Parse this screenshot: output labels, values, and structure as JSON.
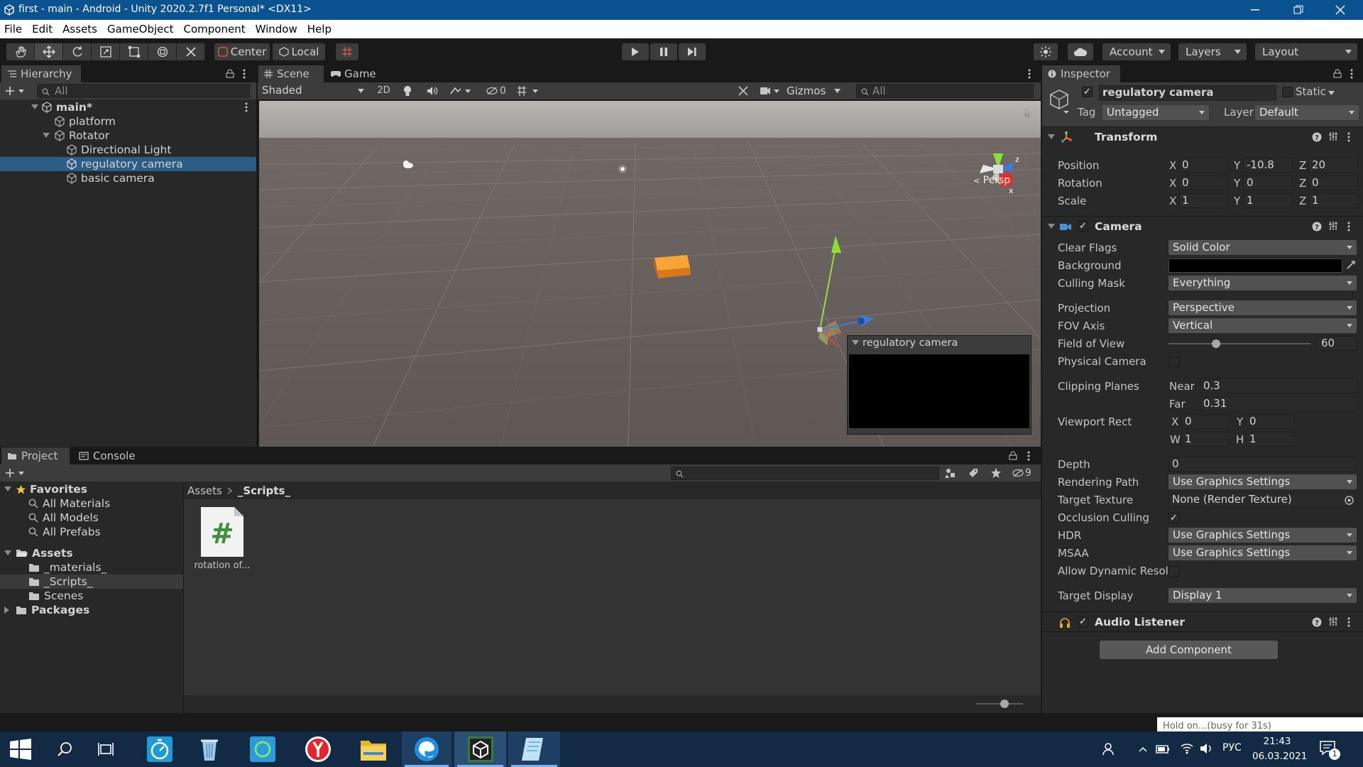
{
  "window": {
    "title": "first - main - Android - Unity 2020.2.7f1 Personal* <DX11>"
  },
  "menu": [
    "File",
    "Edit",
    "Assets",
    "GameObject",
    "Component",
    "Window",
    "Help"
  ],
  "toolbar": {
    "pivot": "Center",
    "space": "Local",
    "account": "Account",
    "layers": "Layers",
    "layout": "Layout"
  },
  "hierarchy": {
    "tab": "Hierarchy",
    "search_placeholder": "All",
    "scene": "main*",
    "items": [
      "platform",
      "Rotator",
      "Directional Light",
      "regulatory camera",
      "basic camera"
    ]
  },
  "scene_view": {
    "tab_scene": "Scene",
    "tab_game": "Game",
    "shading": "Shaded",
    "mode_2d": "2D",
    "hidden_count": "0",
    "gizmos": "Gizmos",
    "search_placeholder": "All",
    "persp": "Persp",
    "gizmo_axis_z": "z",
    "gizmo_axis_x": "x",
    "preview_title": "regulatory camera"
  },
  "inspector": {
    "tab": "Inspector",
    "object_name": "regulatory camera",
    "static": "Static",
    "tag_label": "Tag",
    "tag": "Untagged",
    "layer_label": "Layer",
    "layer": "Default",
    "transform": {
      "title": "Transform",
      "position": {
        "label": "Position",
        "x": "0",
        "y": "-10.8",
        "z": "20"
      },
      "rotation": {
        "label": "Rotation",
        "x": "0",
        "y": "0",
        "z": "0"
      },
      "scale": {
        "label": "Scale",
        "x": "1",
        "y": "1",
        "z": "1"
      }
    },
    "camera": {
      "title": "Camera",
      "clear_flags_label": "Clear Flags",
      "clear_flags": "Solid Color",
      "background_label": "Background",
      "culling_label": "Culling Mask",
      "culling": "Everything",
      "projection_label": "Projection",
      "projection": "Perspective",
      "fov_axis_label": "FOV Axis",
      "fov_axis": "Vertical",
      "fov_label": "Field of View",
      "fov": "60",
      "physical_label": "Physical Camera",
      "clipping_label": "Clipping Planes",
      "near_label": "Near",
      "near": "0.3",
      "far_label": "Far",
      "far": "0.31",
      "viewport_label": "Viewport Rect",
      "vx": "0",
      "vy": "0",
      "vw": "1",
      "vh": "1",
      "depth_label": "Depth",
      "depth": "0",
      "rendering_label": "Rendering Path",
      "rendering": "Use Graphics Settings",
      "target_tex_label": "Target Texture",
      "target_tex": "None (Render Texture)",
      "occlusion_label": "Occlusion Culling",
      "hdr_label": "HDR",
      "hdr": "Use Graphics Settings",
      "msaa_label": "MSAA",
      "msaa": "Use Graphics Settings",
      "dyn_label": "Allow Dynamic Resol",
      "display_label": "Target Display",
      "display": "Display 1"
    },
    "audio": {
      "title": "Audio Listener"
    },
    "add_component": "Add Component"
  },
  "project": {
    "tab_project": "Project",
    "tab_console": "Console",
    "hidden_count": "9",
    "favorites": "Favorites",
    "fav_items": [
      "All Materials",
      "All Models",
      "All Prefabs"
    ],
    "assets": "Assets",
    "asset_folders": [
      "_materials_",
      "_Scripts_",
      "Scenes"
    ],
    "packages": "Packages",
    "breadcrumb_root": "Assets",
    "breadcrumb_current": "_Scripts_",
    "files": [
      "rotation of..."
    ]
  },
  "status": {
    "busy": "Hold on...(busy for 31s)"
  },
  "taskbar": {
    "lang": "РУС",
    "time": "21:43",
    "date": "06.03.2021",
    "notif_count": "1"
  },
  "colors": {
    "accent": "#2c5d87",
    "selection": "#2c5d87",
    "orange_box": "#f08c1c",
    "taskbar": "#132a45"
  }
}
